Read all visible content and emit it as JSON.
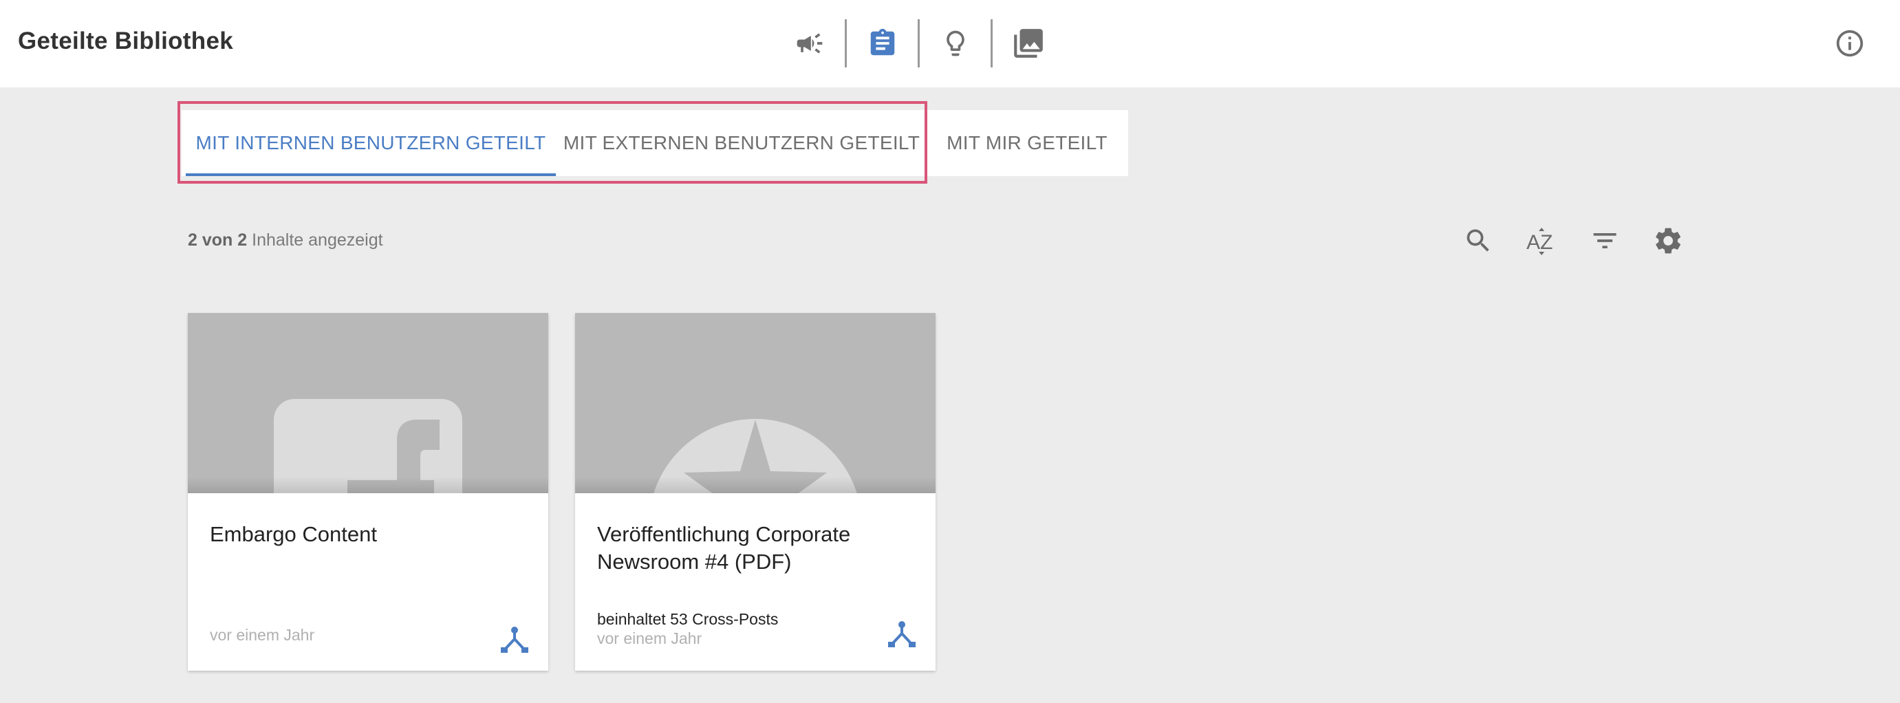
{
  "header": {
    "title": "Geteilte Bibliothek",
    "nav_icons": [
      "megaphone-icon",
      "clipboard-icon",
      "lightbulb-icon",
      "photo-library-icon"
    ],
    "active_nav": "clipboard-icon",
    "info_icon": "info-icon"
  },
  "tabs": [
    {
      "label": "MIT INTERNEN BENUTZERN GETEILT",
      "active": true
    },
    {
      "label": "MIT EXTERNEN BENUTZERN GETEILT",
      "active": false
    },
    {
      "label": "MIT MIR GETEILT",
      "active": false
    }
  ],
  "results": {
    "shown": "2",
    "word_of": "von",
    "total": "2",
    "suffix": "Inhalte angezeigt"
  },
  "toolbar": {
    "icons": [
      "search-icon",
      "sort-az-icon",
      "filter-icon",
      "settings-icon"
    ]
  },
  "cards": [
    {
      "title": "Embargo Content",
      "meta": "",
      "time": "vor einem Jahr",
      "thumb_icon": "facebook-icon"
    },
    {
      "title": "Veröffentlichung Corporate Newsroom #4 (PDF)",
      "meta": "beinhaltet 53 Cross-Posts",
      "time": "vor einem Jahr",
      "thumb_icon": "star-badge-icon"
    }
  ],
  "colors": {
    "accent": "#4a7dc4",
    "highlight": "#d95678",
    "background": "#ececec",
    "placeholder": "#b8b8b8"
  }
}
